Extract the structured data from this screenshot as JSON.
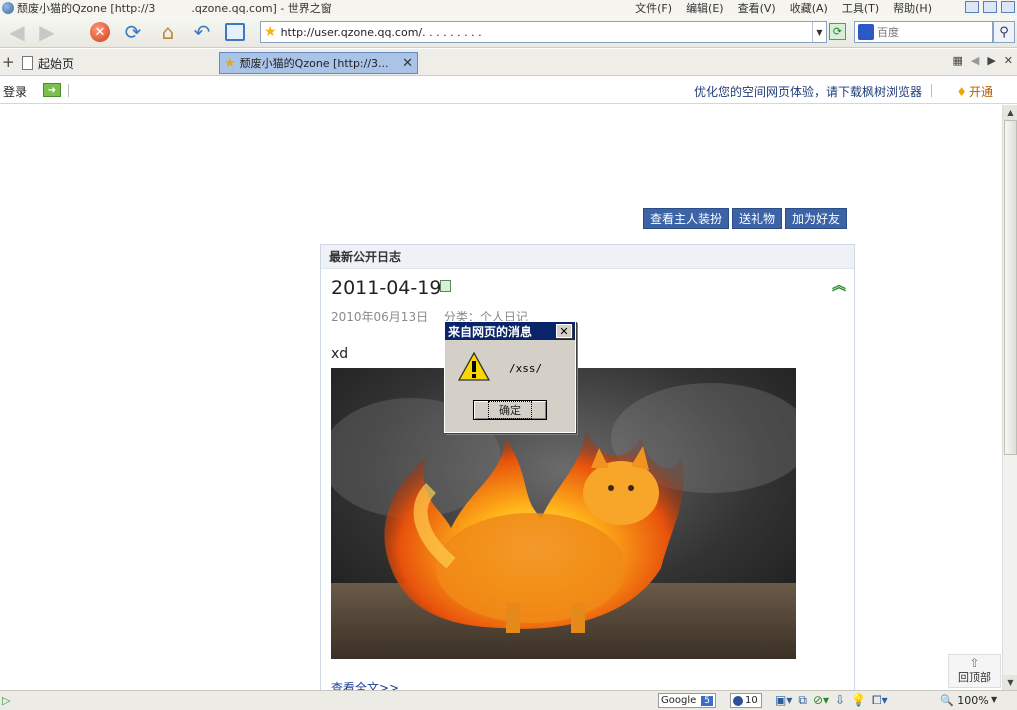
{
  "window": {
    "title": "颓废小猫的Qzone [http://3        .qzone.qq.com] - 世界之窗"
  },
  "menu": [
    "文件(F)",
    "编辑(E)",
    "查看(V)",
    "收藏(A)",
    "工具(T)",
    "帮助(H)"
  ],
  "toolbar": {
    "address": "http://user.qzone.qq.com/. . . . . . . . .",
    "search_placeholder": "百度"
  },
  "tabs": {
    "start_page": "起始页",
    "active_title": "颓废小猫的Qzone [http://3..."
  },
  "infobar": {
    "login": "登录",
    "promo": "优化您的空间网页体验，请下载枫树浏览器",
    "open_vip": "开通"
  },
  "page": {
    "action_buttons": [
      "查看主人装扮",
      "送礼物",
      "加为好友"
    ],
    "panel_title": "最新公开日志",
    "post": {
      "title": "2011-04-19",
      "meta": "2010年06月13日  分类：个人日记",
      "text": "xd",
      "read_more": "查看全文>>"
    },
    "back_to_top": "回顶部"
  },
  "alert": {
    "caption": "来自网页的消息",
    "message": "/xss/",
    "ok_label": "确定"
  },
  "statusbar": {
    "google": "Google",
    "google_count": "5",
    "mail_count": "10",
    "zoom": "100%"
  },
  "colors": {
    "accent": "#3b63a6",
    "dialog_caption": "#0a246a",
    "active_tab": "#a9c4e7"
  }
}
